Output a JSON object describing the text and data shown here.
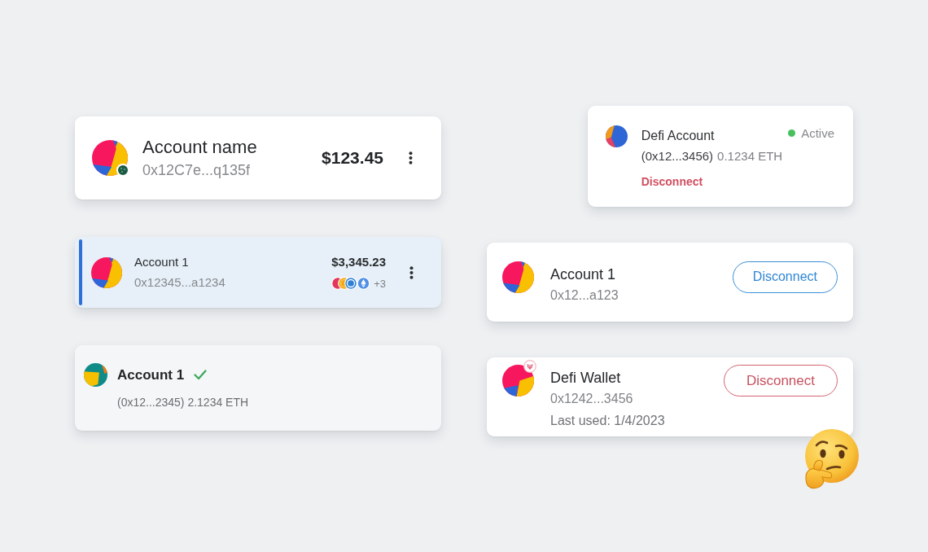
{
  "account_cards": [
    {
      "kind": "large",
      "name": "Account name",
      "address": "0x12C7e...q135f",
      "balance": "$123.45",
      "avatar_badge": {
        "kind": "network"
      },
      "selected": false
    },
    {
      "kind": "compact",
      "name": "Account 1",
      "address": "0x12345...a1234",
      "balance": "$3,345.23",
      "token_count": "+3",
      "selected": true
    },
    {
      "kind": "picker",
      "name": "Account 1",
      "details": "(0x12...2345) 2.1234 ETH",
      "checked": true,
      "selected": false
    }
  ],
  "connection_cards": [
    {
      "kind": "status",
      "name": "Defi Account",
      "address": "(0x12...3456)",
      "balance": "0.1234 ETH",
      "status": "Active",
      "active": true,
      "action": "Disconnect"
    },
    {
      "kind": "button",
      "name": "Account 1",
      "address": "0x12...a123",
      "button": {
        "kind": "primary",
        "label": "Disconnect"
      }
    },
    {
      "kind": "button",
      "name": "Defi Wallet",
      "address": "0x1242...3456",
      "last_used": "Last used: 1/4/2023",
      "button": {
        "kind": "danger",
        "label": "Disconnect"
      },
      "avatar_badge": {
        "kind": "app"
      }
    }
  ]
}
